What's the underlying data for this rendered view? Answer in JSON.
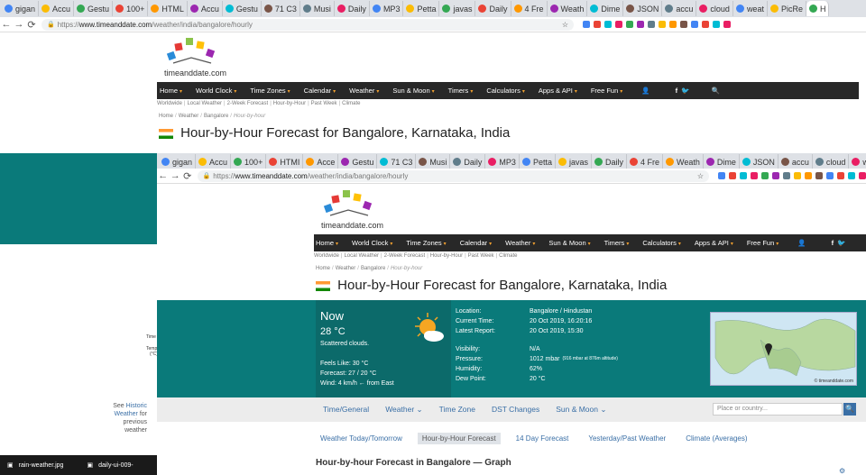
{
  "browser": {
    "tabs": [
      "gigan",
      "Accu",
      "Gestu",
      "100+",
      "HTML",
      "Accu",
      "Gestu",
      "71 C3",
      "Musi",
      "Daily",
      "MP3",
      "Petta",
      "javas",
      "Daily",
      "4 Fre",
      "Weath",
      "Dime",
      "JSON",
      "accu",
      "cloud",
      "weat",
      "PicRe",
      "H"
    ],
    "tabs_inner": [
      "gigan",
      "Accu",
      "100+",
      "HTMI",
      "Acce",
      "Gestu",
      "71 C3",
      "Musi",
      "Daily",
      "MP3",
      "Petta",
      "javas",
      "Daily",
      "4 Fre",
      "Weath",
      "Dime",
      "JSON",
      "accu",
      "cloud",
      "wea"
    ],
    "url_scheme": "https://",
    "url_domain": "www.timeanddate.com",
    "url_path": "/weather/india/bangalore/hourly",
    "nav_back": "←",
    "nav_forward": "→",
    "nav_reload": "C"
  },
  "site": {
    "logo": "timeanddate.com",
    "nav": [
      "Home",
      "World Clock",
      "Time Zones",
      "Calendar",
      "Weather",
      "Sun & Moon",
      "Timers",
      "Calculators",
      "Apps & API",
      "Free Fun"
    ],
    "social": "f",
    "subcrumbs": [
      "Worldwide",
      "Local Weather",
      "2-Week Forecast",
      "Hour-by-Hour",
      "Past Week",
      "Climate"
    ],
    "breadcrumb": [
      "Home",
      "Weather",
      "Bangalore",
      "Hour-by-hour"
    ],
    "page_title": "Hour-by-Hour Forecast for Bangalore, Karnataka, India"
  },
  "now": {
    "label": "Now",
    "temp": "28 °C",
    "desc": "Scattered clouds.",
    "feels": "Feels Like: 30 °C",
    "forecast": "Forecast: 27 / 20 °C",
    "wind": "Wind: 4 km/h ← from East"
  },
  "details": [
    {
      "label": "Location:",
      "value": "Bangalore / Hindustan"
    },
    {
      "label": "Current Time:",
      "value": "20 Oct 2019, 16:20:16"
    },
    {
      "label": "Latest Report:",
      "value": "20 Oct 2019, 15:30"
    },
    {
      "label": "Visibility:",
      "value": "N/A"
    },
    {
      "label": "Pressure:",
      "value": "1012 mbar",
      "note": "(916 mbar at 876m altitude)"
    },
    {
      "label": "Humidity:",
      "value": "62%"
    },
    {
      "label": "Dew Point:",
      "value": "20 °C"
    }
  ],
  "map_credit": "© timeanddate.com",
  "subnav": [
    "Time/General",
    "Weather",
    "Time Zone",
    "DST Changes",
    "Sun & Moon"
  ],
  "search_placeholder": "Place or country...",
  "views": [
    "Weather Today/Tomorrow",
    "Hour-by-Hour Forecast",
    "14 Day Forecast",
    "Yesterday/Past Weather",
    "Climate (Averages)"
  ],
  "section_title": "Hour-by-hour Forecast in Bangalore — Graph",
  "left": {
    "see": "See",
    "historic": "Historic",
    "weather": "Weather",
    "for": "for",
    "previous": "previous",
    "weather2": "weather",
    "time_lbl": "Time",
    "temp_lbl": "Temp",
    "temp_unit": "(°C)"
  },
  "downloads": [
    "rain-weather.jpg",
    "daily-ui-009-"
  ],
  "colors": {
    "teal": "#0a7a7a",
    "nav": "#282828",
    "link": "#3a6fa6"
  }
}
